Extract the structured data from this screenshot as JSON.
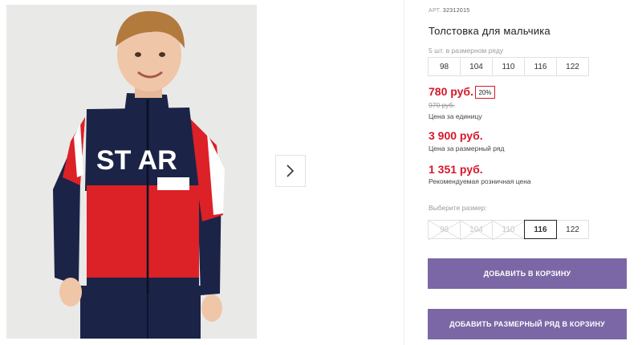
{
  "product": {
    "article_prefix": "АРТ.",
    "article": "32312015",
    "title": "Толстовка для мальчика"
  },
  "size_row": {
    "label": "5 шт. в размерном ряду",
    "sizes": [
      "98",
      "104",
      "110",
      "116",
      "122"
    ]
  },
  "pricing": {
    "unit_price": "780 руб.",
    "discount": "20%",
    "old_price": "970 руб.",
    "unit_label": "Цена за единицу",
    "row_price": "3 900 руб.",
    "row_label": "Цена за размерный ряд",
    "rrp_price": "1 351 руб.",
    "rrp_label": "Рекомендуемая розничная цена"
  },
  "size_picker": {
    "label": "Выберите размер:",
    "options": [
      {
        "value": "98",
        "available": false
      },
      {
        "value": "104",
        "available": false
      },
      {
        "value": "110",
        "available": false
      },
      {
        "value": "116",
        "available": true,
        "selected": true
      },
      {
        "value": "122",
        "available": true
      }
    ]
  },
  "actions": {
    "add_to_cart": "ДОБАВИТЬ В КОРЗИНУ",
    "add_row_to_cart": "ДОБАВИТЬ РАЗМЕРНЫЙ РЯД В КОРЗИНУ"
  },
  "photo": {
    "print_text": "ST AR"
  },
  "colors": {
    "accent_price": "#d6182b",
    "button": "#7b67a5",
    "jacket_red": "#dc2127",
    "jacket_navy": "#1b2447"
  },
  "icons": {
    "next": "chevron-right-icon",
    "unavailable": "cross-out-icon"
  }
}
